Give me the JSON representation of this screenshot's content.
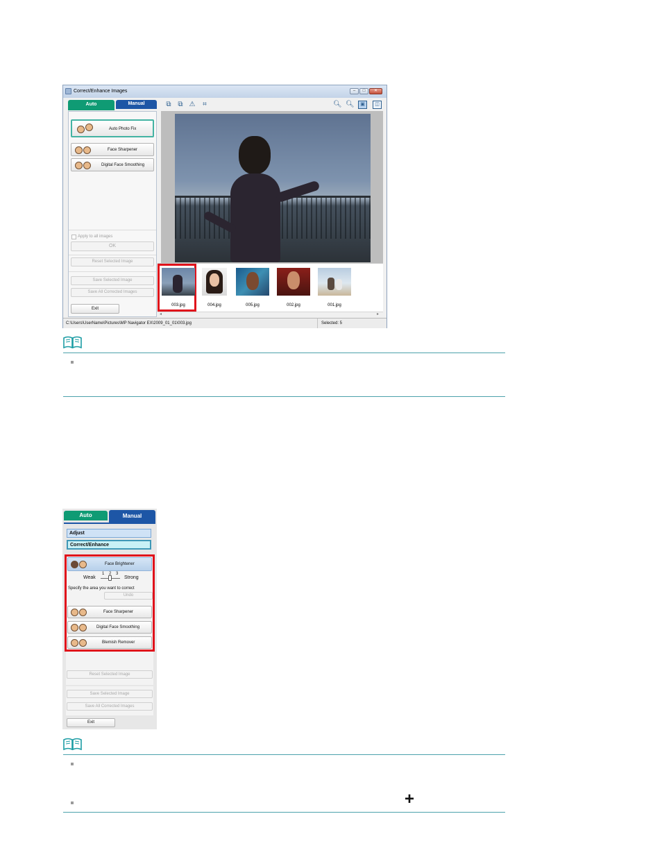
{
  "window": {
    "title": "Correct/Enhance Images",
    "tabs": {
      "auto": "Auto",
      "manual": "Manual"
    },
    "auto_buttons": [
      "Auto Photo Fix",
      "Face Sharpener",
      "Digital Face Smoothing"
    ],
    "apply_all_label": "Apply to all images",
    "ok_label": "OK",
    "reset_label": "Reset Selected Image",
    "save_selected_label": "Save Selected Image",
    "save_all_label": "Save All Corrected Images",
    "exit_label": "Exit",
    "toolbar_icons": [
      "rotate-left-icon",
      "rotate-right-icon",
      "invert-icon",
      "trim-icon",
      "zoom-in-icon",
      "zoom-out-icon",
      "whole-image-view-icon",
      "compare-view-icon"
    ],
    "thumbnails": [
      "003.jpg",
      "004.jpg",
      "005.jpg",
      "002.jpg",
      "001.jpg"
    ],
    "status_path": "C:\\Users\\UserName\\Pictures\\MP Navigator EX\\2009_01_01\\003.jpg",
    "status_selected": "Selected: 5"
  },
  "manual_panel": {
    "tabs": {
      "auto": "Auto",
      "manual": "Manual"
    },
    "categories": [
      "Adjust",
      "Correct/Enhance"
    ],
    "face_brightener": "Face Brightener",
    "weak": "Weak",
    "strong": "Strong",
    "levels": [
      "1",
      "2",
      "3"
    ],
    "specify_text": "Specify the area you want to correct",
    "undo_label": "Undo",
    "tools": [
      "Face Sharpener",
      "Digital Face Smoothing",
      "Blemish Remover"
    ],
    "reset_label": "Reset Selected Image",
    "save_selected_label": "Save Selected Image",
    "save_all_label": "Save All Corrected Images",
    "exit_label": "Exit"
  },
  "colors": {
    "auto_tab": "#0f9b74",
    "manual_tab": "#1d56a6",
    "highlight": "#e0121b",
    "rule": "#4ba1ab"
  },
  "plus_icon": "+"
}
